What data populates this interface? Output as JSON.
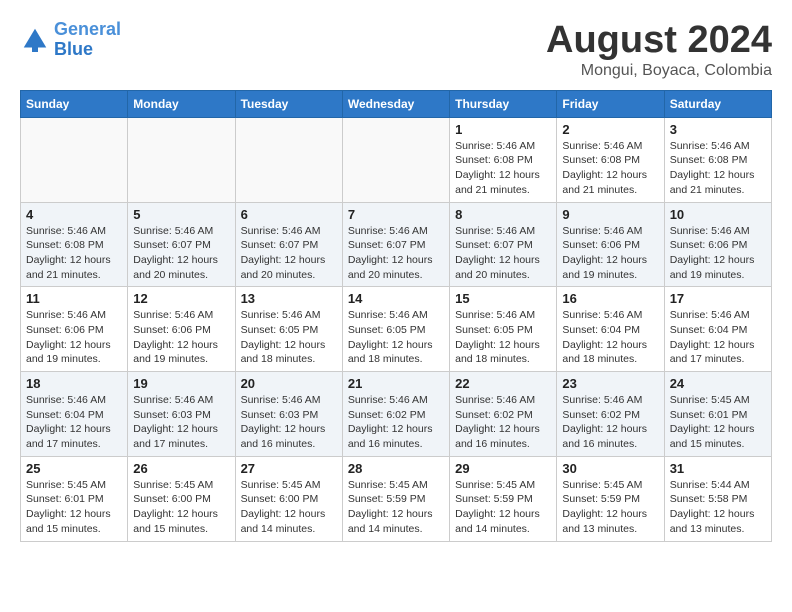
{
  "header": {
    "logo_line1": "General",
    "logo_line2": "Blue",
    "month": "August 2024",
    "location": "Mongui, Boyaca, Colombia"
  },
  "weekdays": [
    "Sunday",
    "Monday",
    "Tuesday",
    "Wednesday",
    "Thursday",
    "Friday",
    "Saturday"
  ],
  "weeks": [
    [
      {
        "day": "",
        "info": ""
      },
      {
        "day": "",
        "info": ""
      },
      {
        "day": "",
        "info": ""
      },
      {
        "day": "",
        "info": ""
      },
      {
        "day": "1",
        "info": "Sunrise: 5:46 AM\nSunset: 6:08 PM\nDaylight: 12 hours\nand 21 minutes."
      },
      {
        "day": "2",
        "info": "Sunrise: 5:46 AM\nSunset: 6:08 PM\nDaylight: 12 hours\nand 21 minutes."
      },
      {
        "day": "3",
        "info": "Sunrise: 5:46 AM\nSunset: 6:08 PM\nDaylight: 12 hours\nand 21 minutes."
      }
    ],
    [
      {
        "day": "4",
        "info": "Sunrise: 5:46 AM\nSunset: 6:08 PM\nDaylight: 12 hours\nand 21 minutes."
      },
      {
        "day": "5",
        "info": "Sunrise: 5:46 AM\nSunset: 6:07 PM\nDaylight: 12 hours\nand 20 minutes."
      },
      {
        "day": "6",
        "info": "Sunrise: 5:46 AM\nSunset: 6:07 PM\nDaylight: 12 hours\nand 20 minutes."
      },
      {
        "day": "7",
        "info": "Sunrise: 5:46 AM\nSunset: 6:07 PM\nDaylight: 12 hours\nand 20 minutes."
      },
      {
        "day": "8",
        "info": "Sunrise: 5:46 AM\nSunset: 6:07 PM\nDaylight: 12 hours\nand 20 minutes."
      },
      {
        "day": "9",
        "info": "Sunrise: 5:46 AM\nSunset: 6:06 PM\nDaylight: 12 hours\nand 19 minutes."
      },
      {
        "day": "10",
        "info": "Sunrise: 5:46 AM\nSunset: 6:06 PM\nDaylight: 12 hours\nand 19 minutes."
      }
    ],
    [
      {
        "day": "11",
        "info": "Sunrise: 5:46 AM\nSunset: 6:06 PM\nDaylight: 12 hours\nand 19 minutes."
      },
      {
        "day": "12",
        "info": "Sunrise: 5:46 AM\nSunset: 6:06 PM\nDaylight: 12 hours\nand 19 minutes."
      },
      {
        "day": "13",
        "info": "Sunrise: 5:46 AM\nSunset: 6:05 PM\nDaylight: 12 hours\nand 18 minutes."
      },
      {
        "day": "14",
        "info": "Sunrise: 5:46 AM\nSunset: 6:05 PM\nDaylight: 12 hours\nand 18 minutes."
      },
      {
        "day": "15",
        "info": "Sunrise: 5:46 AM\nSunset: 6:05 PM\nDaylight: 12 hours\nand 18 minutes."
      },
      {
        "day": "16",
        "info": "Sunrise: 5:46 AM\nSunset: 6:04 PM\nDaylight: 12 hours\nand 18 minutes."
      },
      {
        "day": "17",
        "info": "Sunrise: 5:46 AM\nSunset: 6:04 PM\nDaylight: 12 hours\nand 17 minutes."
      }
    ],
    [
      {
        "day": "18",
        "info": "Sunrise: 5:46 AM\nSunset: 6:04 PM\nDaylight: 12 hours\nand 17 minutes."
      },
      {
        "day": "19",
        "info": "Sunrise: 5:46 AM\nSunset: 6:03 PM\nDaylight: 12 hours\nand 17 minutes."
      },
      {
        "day": "20",
        "info": "Sunrise: 5:46 AM\nSunset: 6:03 PM\nDaylight: 12 hours\nand 16 minutes."
      },
      {
        "day": "21",
        "info": "Sunrise: 5:46 AM\nSunset: 6:02 PM\nDaylight: 12 hours\nand 16 minutes."
      },
      {
        "day": "22",
        "info": "Sunrise: 5:46 AM\nSunset: 6:02 PM\nDaylight: 12 hours\nand 16 minutes."
      },
      {
        "day": "23",
        "info": "Sunrise: 5:46 AM\nSunset: 6:02 PM\nDaylight: 12 hours\nand 16 minutes."
      },
      {
        "day": "24",
        "info": "Sunrise: 5:45 AM\nSunset: 6:01 PM\nDaylight: 12 hours\nand 15 minutes."
      }
    ],
    [
      {
        "day": "25",
        "info": "Sunrise: 5:45 AM\nSunset: 6:01 PM\nDaylight: 12 hours\nand 15 minutes."
      },
      {
        "day": "26",
        "info": "Sunrise: 5:45 AM\nSunset: 6:00 PM\nDaylight: 12 hours\nand 15 minutes."
      },
      {
        "day": "27",
        "info": "Sunrise: 5:45 AM\nSunset: 6:00 PM\nDaylight: 12 hours\nand 14 minutes."
      },
      {
        "day": "28",
        "info": "Sunrise: 5:45 AM\nSunset: 5:59 PM\nDaylight: 12 hours\nand 14 minutes."
      },
      {
        "day": "29",
        "info": "Sunrise: 5:45 AM\nSunset: 5:59 PM\nDaylight: 12 hours\nand 14 minutes."
      },
      {
        "day": "30",
        "info": "Sunrise: 5:45 AM\nSunset: 5:59 PM\nDaylight: 12 hours\nand 13 minutes."
      },
      {
        "day": "31",
        "info": "Sunrise: 5:44 AM\nSunset: 5:58 PM\nDaylight: 12 hours\nand 13 minutes."
      }
    ]
  ]
}
